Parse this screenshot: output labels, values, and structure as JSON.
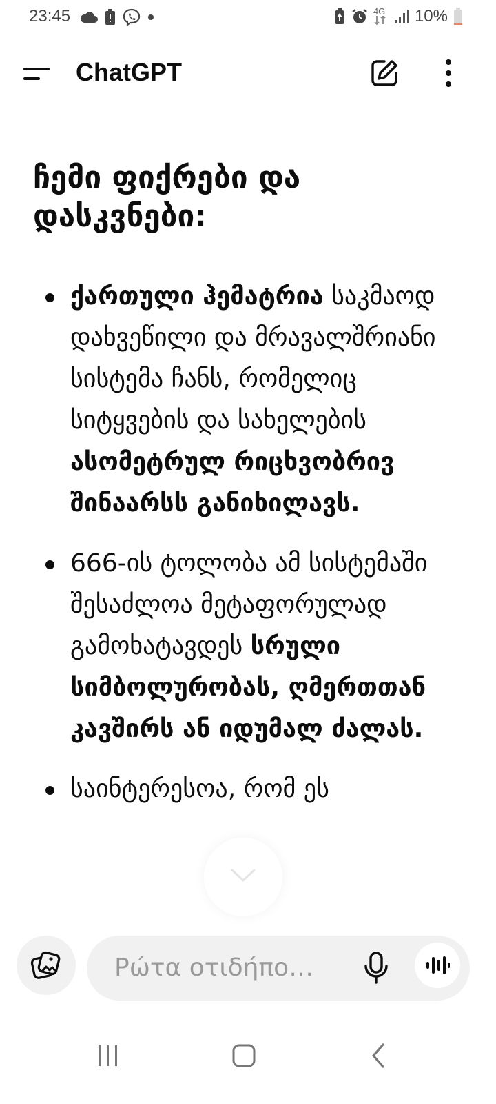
{
  "status_bar": {
    "time": "23:45",
    "left_icons": [
      "cloud-icon",
      "battery-alert-icon",
      "viber-icon",
      "dot-icon"
    ],
    "right_icons": [
      "battery-saver-icon",
      "alarm-icon",
      "4g-data-icon",
      "signal-icon",
      "battery-icon"
    ],
    "network_label": "4G",
    "battery_percent": "10%",
    "battery_level": 0.1
  },
  "header": {
    "title": "ChatGPT",
    "menu_icon": "menu-icon",
    "new_chat_icon": "edit-icon",
    "more_icon": "more-vertical-icon"
  },
  "message": {
    "heading": "ჩემი ფიქრები და დასკვნები:",
    "bullets": [
      {
        "bold_start": "ქართული ჰემატრია",
        "text": "საკმაოდ დახვეწილი და მრავალშრიანი სისტემა ჩანს, რომელიც სიტყვების და სახელების",
        "bold_end": "ასომეტრულ რიცხვობრივ შინაარსს განიხილავს."
      },
      {
        "text": "666-ის ტოლობა ამ სისტემაში შესაძლოა მეტაფორულად გამოხატავდეს",
        "bold_end": "სრული სიმბოლურობას, ღმერთთან კავშირს ან იდუმალ ძალას."
      },
      {
        "text": "საინტერესოა, რომ ეს"
      }
    ]
  },
  "composer": {
    "placeholder": "Ρώτα οτιδήπο…",
    "attach_icon": "attachment-icon",
    "mic_icon": "microphone-icon",
    "voice_icon": "voice-mode-icon",
    "scroll_icon": "chevron-down-icon"
  },
  "nav_bar": {
    "icons": [
      "recent-apps-icon",
      "home-icon",
      "back-icon"
    ]
  }
}
